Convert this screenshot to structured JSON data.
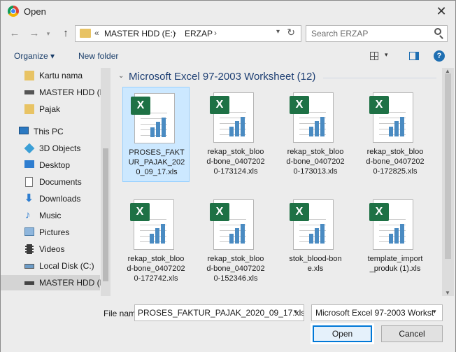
{
  "title": "Open",
  "nav": {
    "breadcrumb_overflow": "«",
    "breadcrumbs": [
      "MASTER HDD (E:)",
      "ERZAP"
    ],
    "search_placeholder": "Search ERZAP"
  },
  "toolbar": {
    "organize": "Organize ▾",
    "new_folder": "New folder"
  },
  "sidebar": {
    "items": [
      {
        "label": "Kartu nama",
        "icon": "folder-icon"
      },
      {
        "label": "MASTER HDD (E",
        "icon": "drive-icon"
      },
      {
        "label": "Pajak",
        "icon": "folder-icon"
      },
      {
        "label": "This PC",
        "icon": "computer-icon"
      },
      {
        "label": "3D Objects",
        "icon": "3d-objects-icon"
      },
      {
        "label": "Desktop",
        "icon": "desktop-icon"
      },
      {
        "label": "Documents",
        "icon": "documents-icon"
      },
      {
        "label": "Downloads",
        "icon": "downloads-icon"
      },
      {
        "label": "Music",
        "icon": "music-icon"
      },
      {
        "label": "Pictures",
        "icon": "pictures-icon"
      },
      {
        "label": "Videos",
        "icon": "videos-icon"
      },
      {
        "label": "Local Disk (C:)",
        "icon": "drive-icon"
      },
      {
        "label": "MASTER HDD (E",
        "icon": "drive-icon"
      }
    ]
  },
  "group": {
    "title": "Microsoft Excel 97-2003 Worksheet (12)"
  },
  "files": [
    {
      "name": "PROSES_FAKTUR_PAJAK_2020_09_17.xls",
      "selected": true
    },
    {
      "name": "rekap_stok_blood-bone_04072020-173124.xls"
    },
    {
      "name": "rekap_stok_blood-bone_04072020-173013.xls"
    },
    {
      "name": "rekap_stok_blood-bone_04072020-172825.xls"
    },
    {
      "name": "rekap_stok_blood-bone_04072020-172742.xls"
    },
    {
      "name": "rekap_stok_blood-bone_04072020-152346.xls"
    },
    {
      "name": "stok_blood-bone.xls"
    },
    {
      "name": "template_import_produk (1).xls"
    }
  ],
  "footer": {
    "file_name_label": "File name:",
    "file_name_value": "PROSES_FAKTUR_PAJAK_2020_09_17.xls",
    "file_type": "Microsoft Excel 97-2003 Workst",
    "open_label": "Open",
    "cancel_label": "Cancel"
  }
}
